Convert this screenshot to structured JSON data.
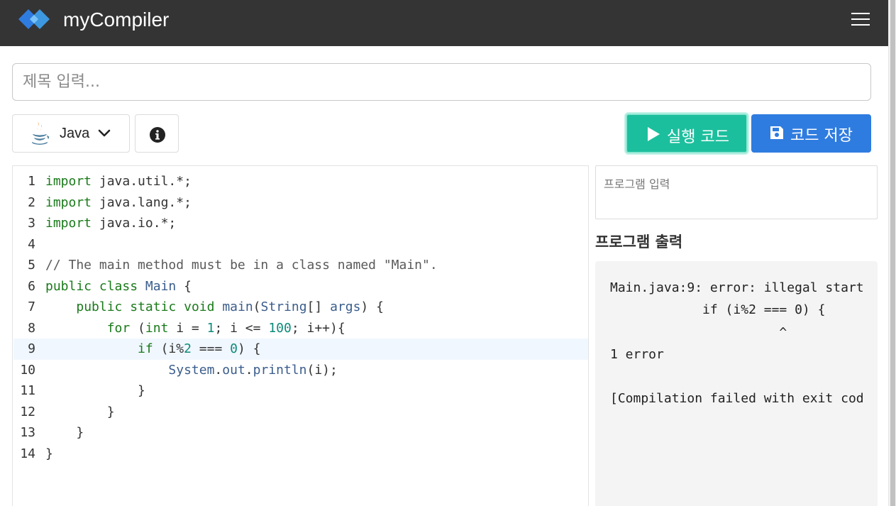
{
  "navbar": {
    "brand": "myCompiler",
    "logo_colors": [
      "#2f7ce0",
      "#3ea3f2"
    ],
    "background": "#343434"
  },
  "title_input": {
    "placeholder": "제목 입력...",
    "value": ""
  },
  "toolbar": {
    "language": "Java",
    "language_icon": "java-icon",
    "info_icon": "info-icon",
    "run_label": "실행 코드",
    "run_icon": "play-icon",
    "run_color": "#1cbf9d",
    "save_label": "코드 저장",
    "save_icon": "floppy-disk-icon",
    "save_color": "#2f7ce0"
  },
  "editor": {
    "active_line": 9,
    "lines": [
      {
        "n": "1",
        "text": "import java.util.*;"
      },
      {
        "n": "2",
        "text": "import java.lang.*;"
      },
      {
        "n": "3",
        "text": "import java.io.*;"
      },
      {
        "n": "4",
        "text": ""
      },
      {
        "n": "5",
        "text": "// The main method must be in a class named \"Main\"."
      },
      {
        "n": "6",
        "text": "public class Main {"
      },
      {
        "n": "7",
        "text": "    public static void main(String[] args) {"
      },
      {
        "n": "8",
        "text": "        for (int i = 1; i <= 100; i++){"
      },
      {
        "n": "9",
        "text": "            if (i%2 === 0) {"
      },
      {
        "n": "10",
        "text": "                System.out.println(i);"
      },
      {
        "n": "11",
        "text": "            }"
      },
      {
        "n": "12",
        "text": "        }"
      },
      {
        "n": "13",
        "text": "    }"
      },
      {
        "n": "14",
        "text": "}"
      }
    ]
  },
  "stdin": {
    "placeholder": "프로그램 입력",
    "value": ""
  },
  "output": {
    "heading": "프로그램 출력",
    "text": "Main.java:9: error: illegal start\n            if (i%2 === 0) {\n                      ^\n1 error\n\n[Compilation failed with exit cod"
  }
}
